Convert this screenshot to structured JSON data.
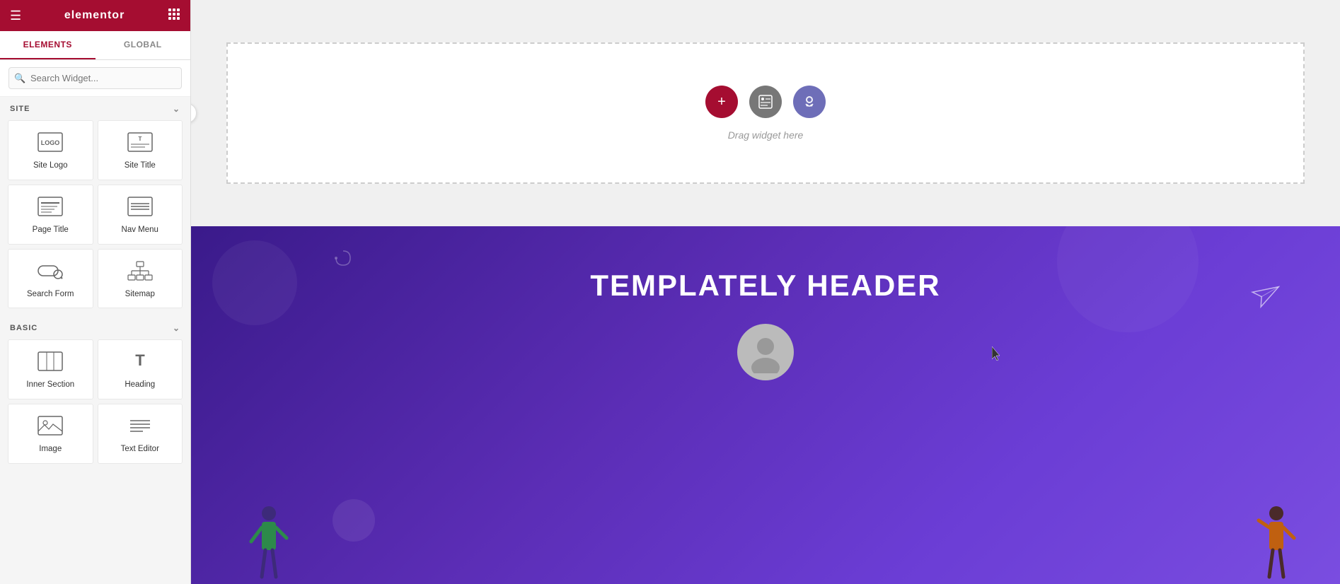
{
  "header": {
    "logo": "elementor",
    "hamburger_icon": "☰",
    "grid_icon": "⊞"
  },
  "tabs": [
    {
      "id": "elements",
      "label": "ELEMENTS",
      "active": true
    },
    {
      "id": "global",
      "label": "GLOBAL",
      "active": false
    }
  ],
  "search": {
    "placeholder": "Search Widget..."
  },
  "sections": [
    {
      "id": "site",
      "label": "SITE",
      "expanded": true,
      "widgets": [
        {
          "id": "site-logo",
          "label": "Site Logo",
          "icon": "logo"
        },
        {
          "id": "site-title",
          "label": "Site Title",
          "icon": "site-title"
        },
        {
          "id": "page-title",
          "label": "Page Title",
          "icon": "page-title"
        },
        {
          "id": "nav-menu",
          "label": "Nav Menu",
          "icon": "nav-menu"
        },
        {
          "id": "search-form",
          "label": "Search Form",
          "icon": "search-form"
        },
        {
          "id": "sitemap",
          "label": "Sitemap",
          "icon": "sitemap"
        }
      ]
    },
    {
      "id": "basic",
      "label": "BASIC",
      "expanded": true,
      "widgets": [
        {
          "id": "inner-section",
          "label": "Inner Section",
          "icon": "inner-section"
        },
        {
          "id": "heading",
          "label": "Heading",
          "icon": "heading"
        },
        {
          "id": "image",
          "label": "Image",
          "icon": "image"
        },
        {
          "id": "text-editor",
          "label": "Text Editor",
          "icon": "text-editor"
        }
      ]
    }
  ],
  "canvas": {
    "drop_hint": "Drag widget here",
    "banner_title": "TEMPLATELY HEADER",
    "add_btn_label": "+",
    "folder_btn_label": "📁",
    "template_btn_label": "🎭"
  }
}
